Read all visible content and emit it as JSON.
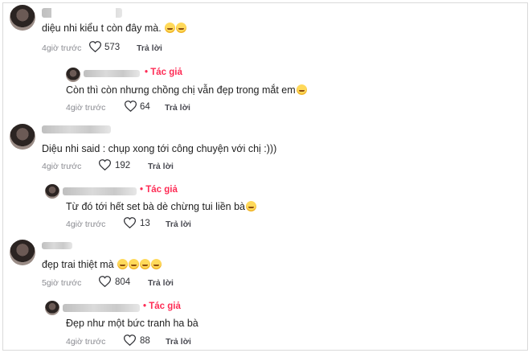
{
  "comments": [
    {
      "text": "diệu nhi kiểu t còn đây mà.",
      "emoji": [
        "grinning-sweat-emoji",
        "relieved-emoji"
      ],
      "time": "4giờ trước",
      "likes": "573",
      "reply_label": "Trả lời",
      "reply": {
        "author_badge": "Tác giả",
        "text": "Còn thì còn nhưng chồng chị vẫn đẹp trong mắt em",
        "emoji": [
          "relieved-emoji"
        ],
        "time": "4giờ trước",
        "likes": "64",
        "reply_label": "Trả lời"
      }
    },
    {
      "text": "Diệu nhi said : chụp xong tới công chuyện với chị :)))",
      "emoji": [],
      "time": "4giờ trước",
      "likes": "192",
      "reply_label": "Trả lời",
      "reply": {
        "author_badge": "Tác giả",
        "text": "Từ đó tới hết set bà dè chừng tui liền bà",
        "emoji": [
          "relieved-emoji"
        ],
        "time": "4giờ trước",
        "likes": "13",
        "reply_label": "Trả lời"
      }
    },
    {
      "text": "đẹp trai thiệt mà",
      "emoji": [
        "laughing-emoji",
        "laughing-emoji",
        "laughing-emoji",
        "laughing-emoji"
      ],
      "time": "5giờ trước",
      "likes": "804",
      "reply_label": "Trả lời",
      "reply": {
        "author_badge": "Tác giả",
        "text": "Đẹp như một bức tranh ha bà",
        "emoji": [],
        "time": "4giờ trước",
        "likes": "88",
        "reply_label": "Trả lời"
      }
    }
  ],
  "colors": {
    "author_badge": "#fe2c55",
    "meta": "#8a8b91",
    "text": "#1f1f1f"
  }
}
